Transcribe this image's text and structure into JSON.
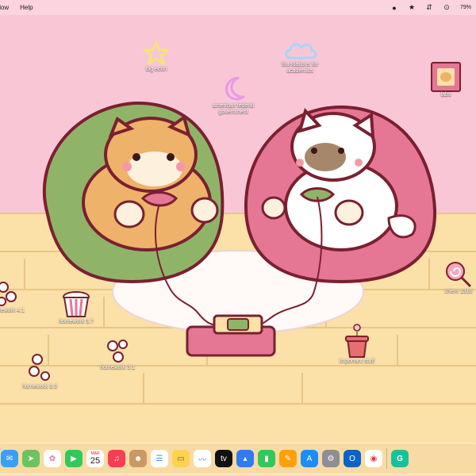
{
  "menubar": {
    "items": [
      "ndow",
      "Help"
    ],
    "battery": "79%"
  },
  "desktop": {
    "icons": [
      {
        "id": "big-econ",
        "label": "big econ"
      },
      {
        "id": "foundations",
        "label": "foundations for academics"
      },
      {
        "id": "american-federal",
        "label": "american federal government"
      },
      {
        "id": "labs",
        "label": "labs"
      },
      {
        "id": "chem",
        "label": "chem 1316"
      },
      {
        "id": "homework-41",
        "label": "homework 4.1"
      },
      {
        "id": "homework-37",
        "label": "homework 3.7"
      },
      {
        "id": "homework-31",
        "label": "homework 3.1"
      },
      {
        "id": "homework-33",
        "label": "homework 3.3"
      },
      {
        "id": "important",
        "label": "important stuff"
      }
    ]
  },
  "dock": {
    "calendar_month": "MAR",
    "calendar_day": "25",
    "apps": [
      "mail-icon",
      "maps-icon",
      "photos-icon",
      "facetime-icon",
      "calendar-icon",
      "music-icon",
      "contacts-icon",
      "reminders-icon",
      "notes-icon",
      "freeform-icon",
      "tv-icon",
      "keynote-icon",
      "numbers-icon",
      "pages-icon",
      "app-store-icon",
      "system-settings-icon",
      "outlook-icon",
      "chrome-icon",
      "grammarly-icon"
    ]
  },
  "colors": {
    "wall": "#f9c6d6",
    "floor": "#fbe0a8",
    "green_beanbag": "#8fb468",
    "pink_beanbag": "#e57794",
    "outline": "#7a2030"
  }
}
